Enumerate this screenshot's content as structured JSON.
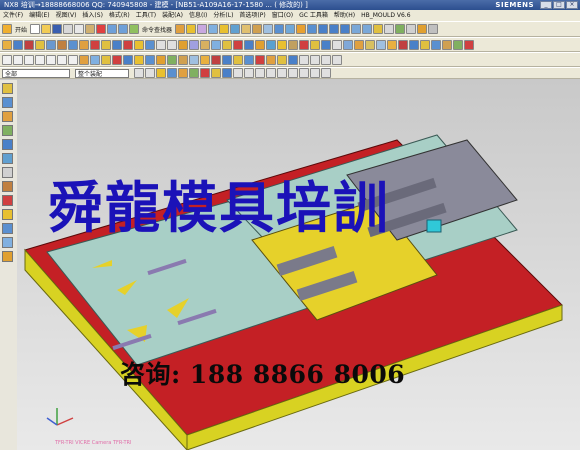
{
  "window": {
    "title": "NX8 培训→18888668006 QQ: 740945808 - 建模 - [NB51-A109A16-17-1580 ... ( 修改的) ]",
    "brand": "SIEMENS",
    "controls": [
      "_",
      "□",
      "×"
    ]
  },
  "menu": [
    "文件(F)",
    "编辑(E)",
    "视图(V)",
    "插入(S)",
    "格式(R)",
    "工具(T)",
    "装配(A)",
    "信息(I)",
    "分析(L)",
    "首选项(P)",
    "窗口(O)",
    "GC 工具箱",
    "帮助(H)",
    "HB_MOULD V6.6"
  ],
  "toolbar": {
    "start_label": "开始",
    "command_finder_label": "命令查找器",
    "filter_dropdown": "整个装配",
    "selection_dropdown": "全部"
  },
  "watermark": "舜龍模具培訓",
  "contact": "咨询: 188 8866 8006",
  "status_text": "TFR-TRI VICRE Camera TFR-TRI",
  "colors": {
    "die_base": "#c42025",
    "plate": "#a8cfc6",
    "insert": "#e6d12a",
    "bottom_plate": "#d8d222",
    "watermark": "#1b12b8"
  }
}
